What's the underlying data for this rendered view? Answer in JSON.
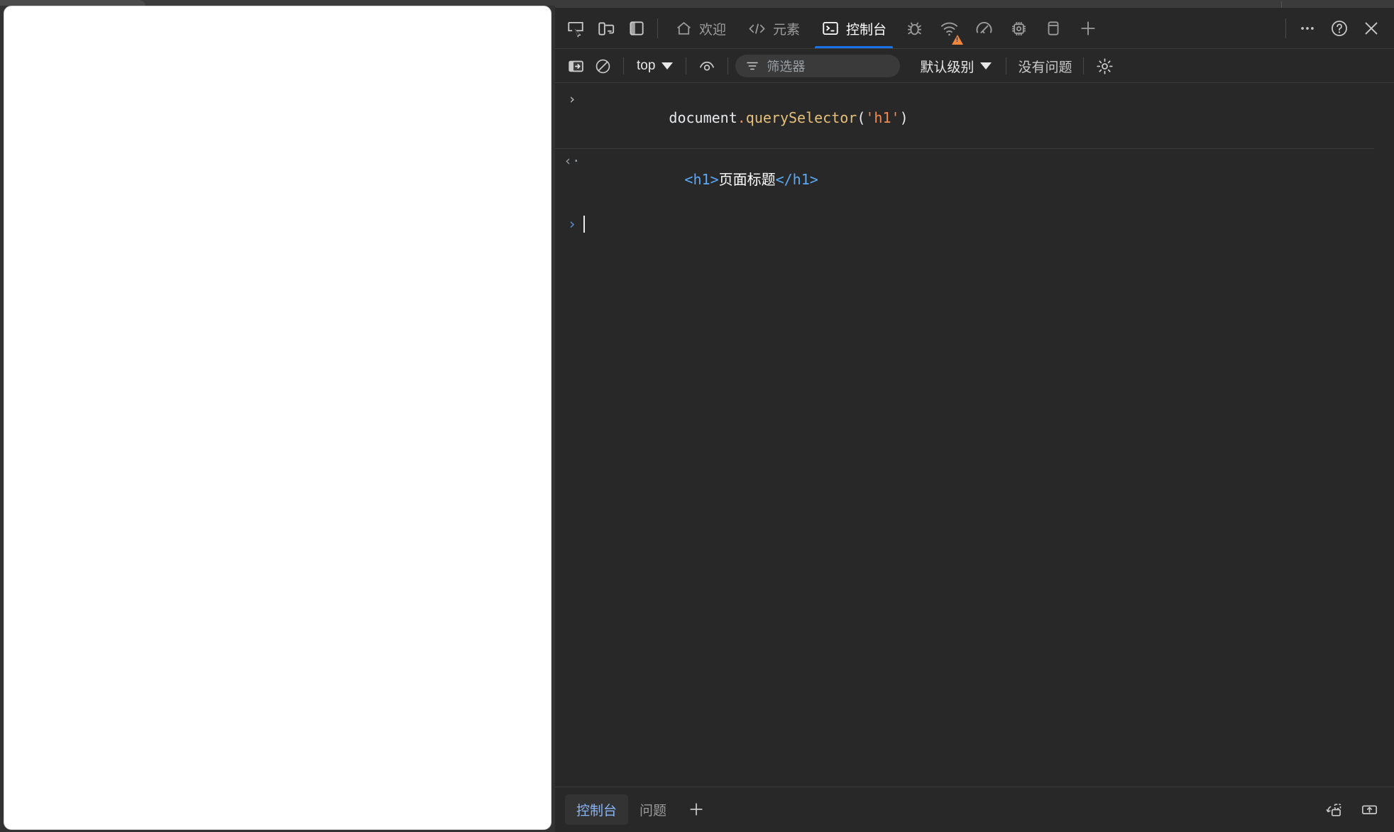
{
  "window": {
    "page_background": "#ffffff",
    "chrome_background": "#323232",
    "devtools_background": "#282828",
    "accent_blue": "#1a73e8"
  },
  "devtools": {
    "left_controls": [
      {
        "name": "inspect-element-icon",
        "tooltip": "检查"
      },
      {
        "name": "device-toolbar-icon",
        "tooltip": "切换设备工具栏"
      },
      {
        "name": "dock-side-icon",
        "tooltip": "停靠侧边"
      }
    ],
    "tabs": [
      {
        "id": "welcome",
        "label": "欢迎",
        "icon": "home-icon",
        "active": false
      },
      {
        "id": "elements",
        "label": "元素",
        "icon": "code-brackets-icon",
        "active": false
      },
      {
        "id": "console",
        "label": "控制台",
        "icon": "terminal-icon",
        "active": true
      },
      {
        "id": "sources",
        "label": "",
        "icon": "bug-icon",
        "active": false
      },
      {
        "id": "network",
        "label": "",
        "icon": "wifi-icon",
        "active": false,
        "badge": "warning"
      },
      {
        "id": "performance",
        "label": "",
        "icon": "gauge-icon",
        "active": false
      },
      {
        "id": "memory",
        "label": "",
        "icon": "chip-icon",
        "active": false
      },
      {
        "id": "application",
        "label": "",
        "icon": "database-icon",
        "active": false
      },
      {
        "id": "more-tabs",
        "label": "",
        "icon": "plus-icon",
        "active": false
      }
    ],
    "right_controls": [
      {
        "name": "more-options-icon",
        "glyph": "…"
      },
      {
        "name": "help-icon",
        "glyph": "?"
      },
      {
        "name": "close-devtools-icon",
        "glyph": "×"
      }
    ]
  },
  "console_toolbar": {
    "sidebar_toggle": {
      "name": "console-sidebar-toggle",
      "active": true
    },
    "clear_console": {
      "name": "clear-console-icon"
    },
    "context_selector": {
      "value": "top"
    },
    "live_expression": {
      "name": "eye-icon"
    },
    "filter": {
      "placeholder": "筛选器",
      "value": ""
    },
    "level_selector": {
      "value": "默认级别"
    },
    "issues": {
      "label": "没有问题"
    },
    "settings": {
      "name": "settings-gear-icon"
    }
  },
  "console_log": {
    "entries": [
      {
        "type": "input",
        "gutter": "›",
        "tokens": [
          {
            "text": "document",
            "cls": "tok-plain"
          },
          {
            "text": ".",
            "cls": "tok-dot"
          },
          {
            "text": "querySelector",
            "cls": "tok-fn"
          },
          {
            "text": "(",
            "cls": "tok-paren"
          },
          {
            "text": "'h1'",
            "cls": "tok-str"
          },
          {
            "text": ")",
            "cls": "tok-paren"
          }
        ],
        "plain": "document.querySelector('h1')"
      },
      {
        "type": "output",
        "gutter": "‹·",
        "tokens": [
          {
            "text": "<h1>",
            "cls": "tok-tag"
          },
          {
            "text": "页面标题",
            "cls": "tok-txt"
          },
          {
            "text": "</h1>",
            "cls": "tok-tag"
          }
        ],
        "plain": "<h1>页面标题</h1>"
      }
    ],
    "prompt": {
      "chevron": "›",
      "value": ""
    }
  },
  "drawer": {
    "tabs": [
      {
        "id": "console",
        "label": "控制台",
        "active": true
      },
      {
        "id": "issues",
        "label": "问题",
        "active": false
      }
    ],
    "add_tab": {
      "name": "add-drawer-tab-icon",
      "glyph": "+"
    },
    "right_icons": [
      {
        "name": "restore-drawer-icon"
      },
      {
        "name": "dock-drawer-icon"
      }
    ]
  }
}
